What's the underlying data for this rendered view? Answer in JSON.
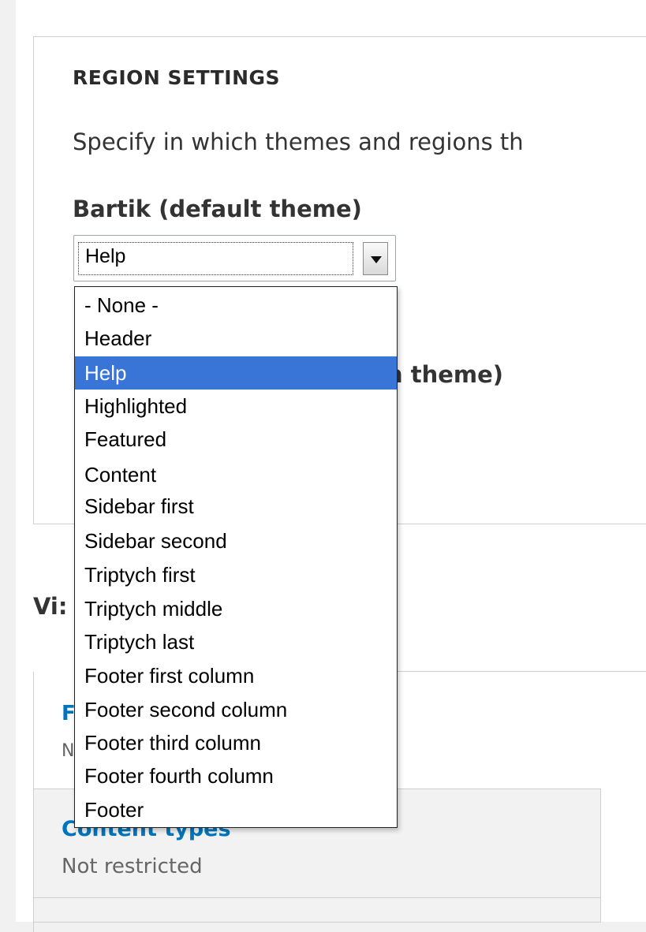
{
  "region_settings": {
    "legend": "REGION SETTINGS",
    "description": "Specify in which themes and regions th",
    "theme_1_label": "Bartik (default theme)",
    "theme_2_label_visible": "n theme)",
    "region_select": {
      "value": "Help",
      "options": [
        "- None -",
        "Header",
        "Help",
        "Highlighted",
        "Featured",
        "Content",
        "Sidebar first",
        "Sidebar second",
        "Triptych first",
        "Triptych middle",
        "Triptych last",
        "Footer first column",
        "Footer second column",
        "Footer third column",
        "Footer fourth column",
        "Footer"
      ],
      "selected_index": 2
    }
  },
  "visibility": {
    "heading_visible": "Vi:",
    "tabs": [
      {
        "title_visible": "F",
        "summary_visible": "N"
      },
      {
        "title_visible": "Content types",
        "summary": "Not restricted"
      }
    ]
  },
  "colors": {
    "selection": "#3875d7",
    "link": "#0074bd",
    "border": "#cfcfcf",
    "page_background": "#f1f1f1"
  }
}
